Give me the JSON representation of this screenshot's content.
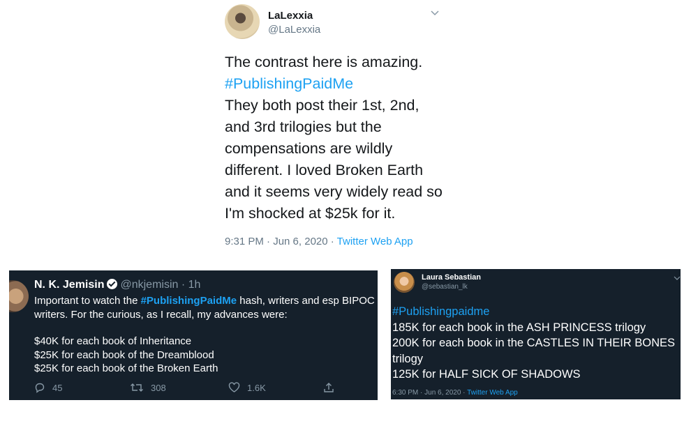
{
  "main_tweet": {
    "display_name": "LaLexxia",
    "handle": "@LaLexxia",
    "text_line1": "The contrast here is amazing.",
    "hashtag": "#PublishingPaidMe",
    "text_rest": "They both post their 1st, 2nd, and 3rd trilogies but the compensations are wildly different. I loved Broken Earth and it seems very widely read so I'm shocked at $25k for it.",
    "time": "9:31 PM · Jun 6, 2020 · ",
    "source": "Twitter Web App",
    "menu_icon": "chevron-down-icon"
  },
  "jemisin_tweet": {
    "display_name": "N. K. Jemisin",
    "handle_time": "@nkjemisin · 1h",
    "text_pre": "Important to watch the ",
    "hashtag": "#PublishingPaidMe",
    "text_post": " hash, writers and esp BIPOC writers. For the curious, as I recall, my advances were:",
    "advances": [
      "$40K for each book of Inheritance",
      "$25K for each book of the Dreamblood",
      "$25K for each book of the Broken Earth"
    ],
    "actions": {
      "reply_count": "45",
      "retweet_count": "308",
      "like_count": "1.6K"
    }
  },
  "sebastian_tweet": {
    "display_name": "Laura Sebastian",
    "handle": "@sebastian_lk",
    "hashtag": "#Publishingpaidme",
    "lines": [
      "185K for each book in the ASH PRINCESS trilogy",
      "200K for each book in the CASTLES IN THEIR BONES trilogy",
      "125K for HALF SICK OF SHADOWS"
    ],
    "time": "6:30 PM · Jun 6, 2020 · ",
    "source": "Twitter Web App"
  },
  "colors": {
    "dark_bg": "#15202b",
    "accent": "#1da1f2",
    "muted_light": "#657786",
    "muted_dark": "#8899a6"
  }
}
